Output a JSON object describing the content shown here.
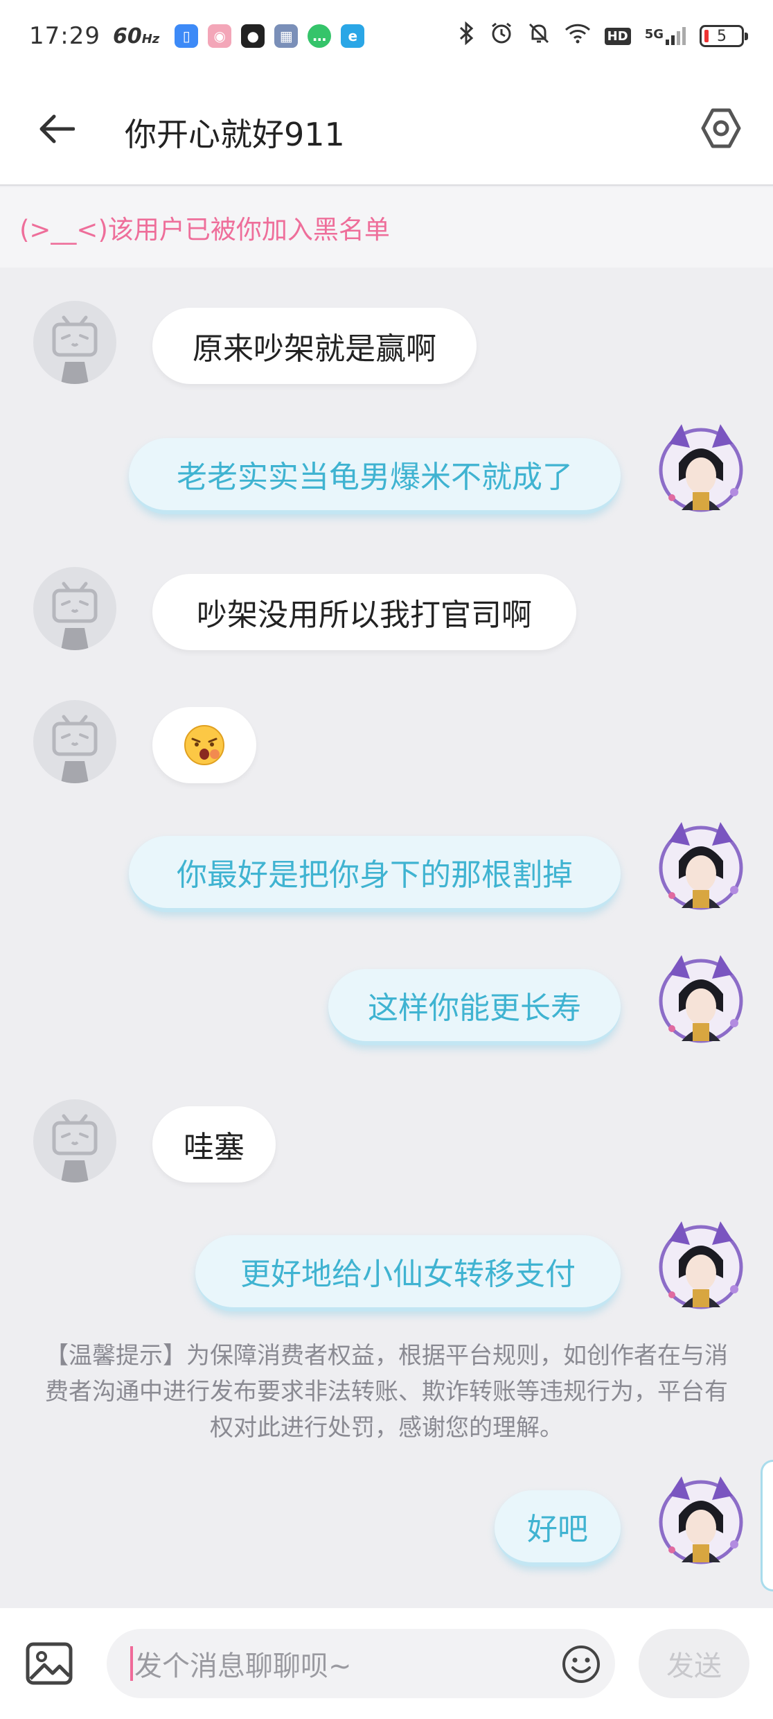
{
  "status_bar": {
    "time": "17:29",
    "refresh_rate": "60",
    "refresh_unit": "Hz",
    "hd": "HD",
    "network": "5G",
    "battery": "5"
  },
  "header": {
    "title": "你开心就好911"
  },
  "notice": {
    "blacklist": "(>__<)该用户已被你加入黑名单"
  },
  "messages": [
    {
      "side": "left",
      "text": "原来吵架就是赢啊"
    },
    {
      "side": "right",
      "text": "老老实实当龟男爆米不就成了"
    },
    {
      "side": "left",
      "text": "吵架没用所以我打官司啊"
    },
    {
      "side": "left",
      "text": "",
      "emoji": "surprised-face"
    },
    {
      "side": "right",
      "text": "你最好是把你身下的那根割掉"
    },
    {
      "side": "right",
      "text": "这样你能更长寿"
    },
    {
      "side": "left",
      "text": "哇塞"
    },
    {
      "side": "right",
      "text": "更好地给小仙女转移支付"
    },
    {
      "side": "right",
      "text": "好吧"
    }
  ],
  "tip": "【温馨提示】为保障消费者权益，根据平台规则，如创作者在与消费者沟通中进行发布要求非法转账、欺诈转账等违规行为，平台有权对此进行处罚，感谢您的理解。",
  "input": {
    "placeholder": "发个消息聊聊呗~",
    "send_label": "发送"
  },
  "colors": {
    "accent_pink": "#ee6e9a",
    "sent_text": "#3fb3d1",
    "sent_bubble": "#e9f6fb"
  }
}
